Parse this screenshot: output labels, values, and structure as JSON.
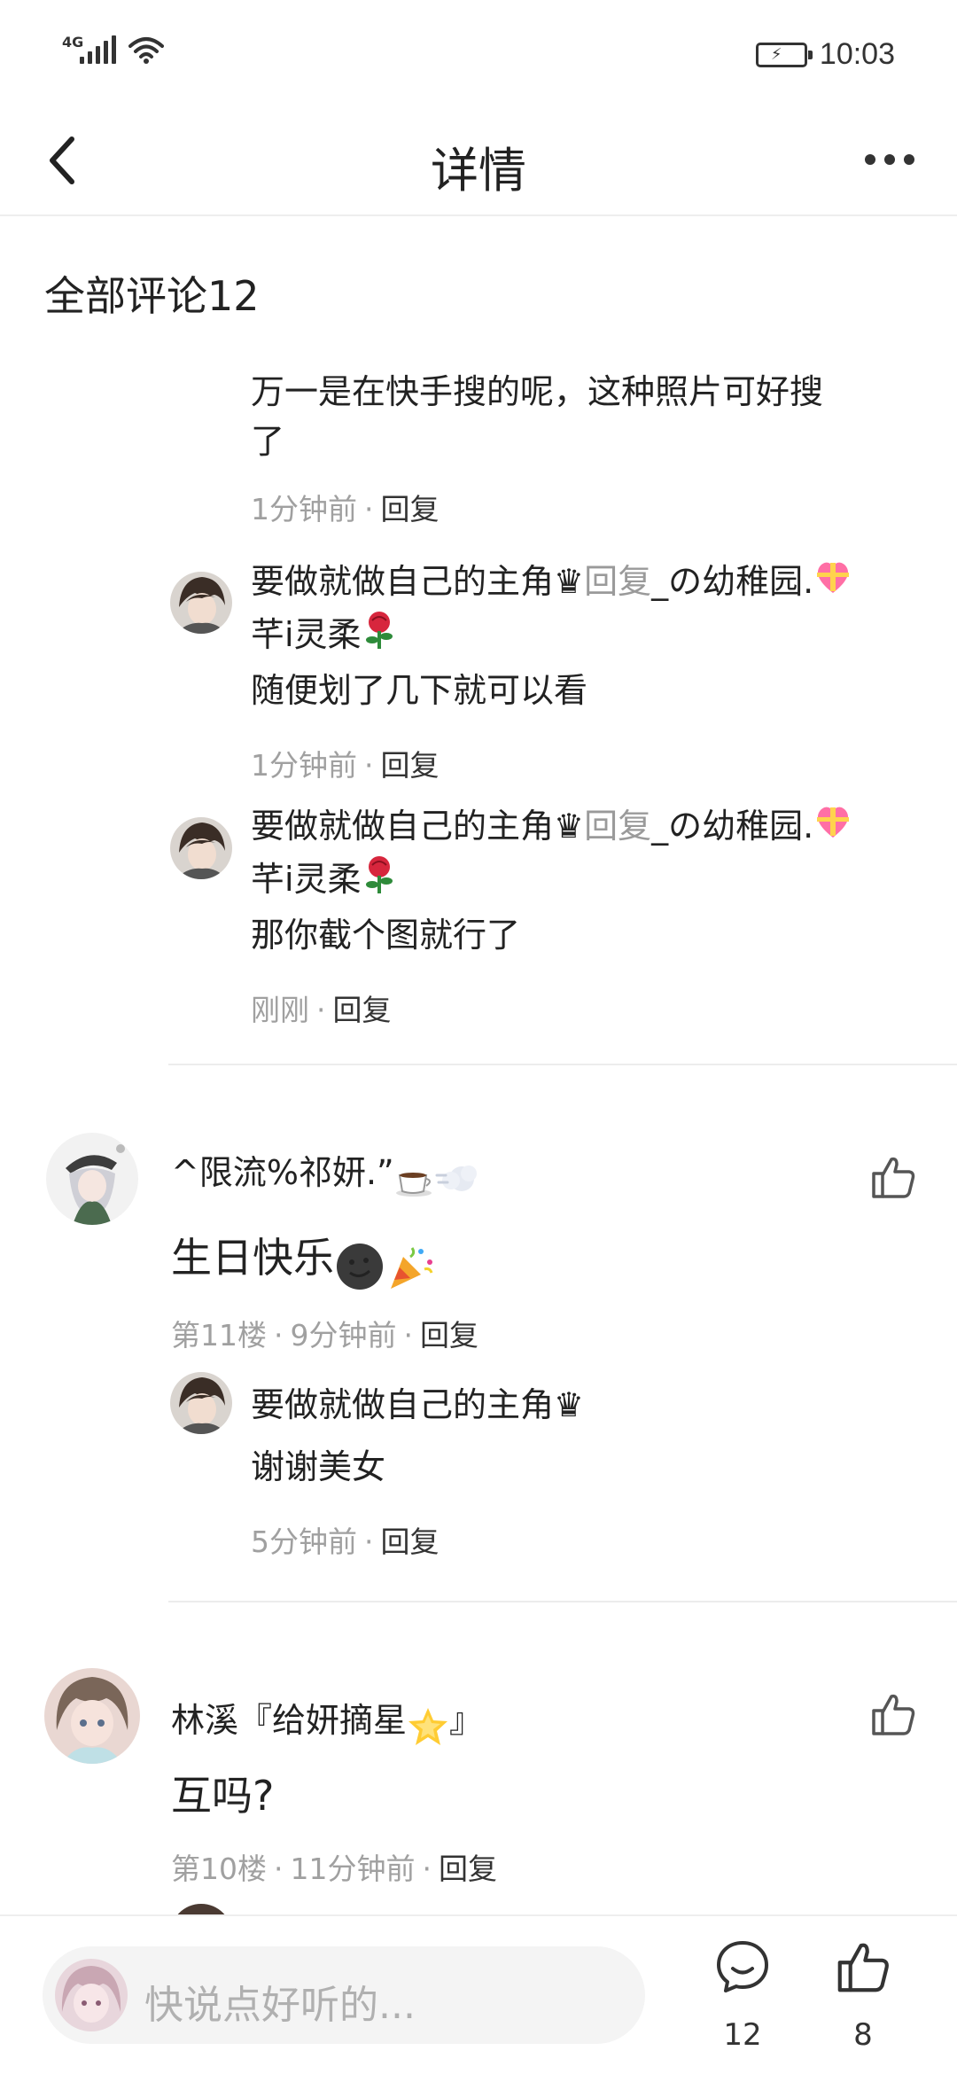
{
  "status_bar": {
    "network": "4G",
    "time": "10:03"
  },
  "nav": {
    "title": "详情"
  },
  "comments_header": "全部评论12",
  "replies_top": [
    {
      "text_line1": "万一是在快手搜的呢，这种照片可好搜",
      "text_line2": "了",
      "time": "1分钟前",
      "reply_label": "回复"
    },
    {
      "author": "要做就做自己的主角♛",
      "reply_word": "回复",
      "target_a": "_の幼稚园.",
      "target_b": "芊i灵柔",
      "text": "随便划了几下就可以看",
      "time": "1分钟前",
      "reply_label": "回复"
    },
    {
      "author": "要做就做自己的主角♛",
      "reply_word": "回复",
      "target_a": "_の幼稚园.",
      "target_b": "芊i灵柔",
      "text": "那你截个图就行了",
      "time": "刚刚",
      "reply_label": "回复"
    }
  ],
  "comment_11": {
    "author": "^限流%祁妍.”",
    "text": "生日快乐",
    "floor": "第11楼",
    "time": "9分钟前",
    "reply_label": "回复",
    "reply": {
      "author": "要做就做自己的主角♛",
      "text": "谢谢美女",
      "time": "5分钟前",
      "reply_label": "回复"
    }
  },
  "comment_10": {
    "author": "林溪『给妍摘星",
    "author_suffix": "』",
    "text": "互吗?",
    "floor": "第10楼",
    "time": "11分钟前",
    "reply_label": "回复"
  },
  "bottom_bar": {
    "placeholder": "快说点好听的...",
    "comment_count": "12",
    "like_count": "8"
  },
  "colors": {
    "text": "#222222",
    "meta": "#a0a0a0",
    "divider": "#ececec"
  }
}
